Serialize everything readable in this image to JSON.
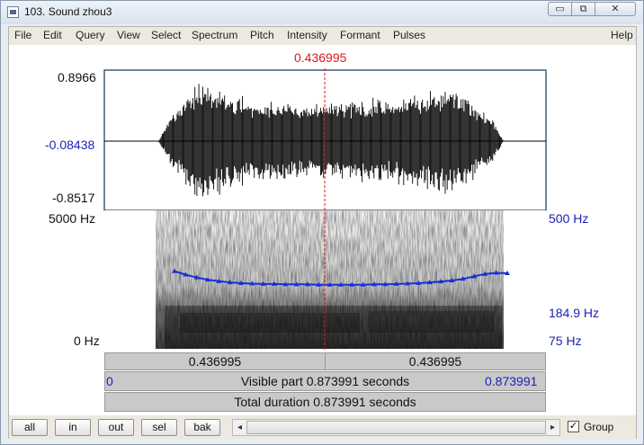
{
  "window": {
    "title": "103. Sound zhou3",
    "min_glyph": "▭",
    "max_glyph": "⧉",
    "close_glyph": "✕"
  },
  "menu": [
    "File",
    "Edit",
    "Query",
    "View",
    "Select",
    "Spectrum",
    "Pitch",
    "Intensity",
    "Formant",
    "Pulses",
    "Help"
  ],
  "cursor_time": "0.436995",
  "waveform": {
    "max": "0.8966",
    "zero_level": "-0.08438",
    "min": "-0.8517"
  },
  "spectrogram": {
    "top_freq": "5000 Hz",
    "bottom_freq": "0 Hz"
  },
  "pitch_axis": {
    "top": "500 Hz",
    "current": "184.9 Hz",
    "bottom": "75 Hz"
  },
  "segments": {
    "left": "0.436995",
    "right": "0.436995"
  },
  "visible": {
    "start": "0",
    "label": "Visible part 0.873991 seconds",
    "end": "0.873991"
  },
  "total": {
    "label": "Total duration 0.873991 seconds"
  },
  "buttons": {
    "all": "all",
    "in": "in",
    "out": "out",
    "sel": "sel",
    "bak": "bak"
  },
  "scroll": {
    "left_arrow": "◂",
    "right_arrow": "▸"
  },
  "group": {
    "label": "Group",
    "checked": "✓"
  },
  "colors": {
    "pitch_curve": "#1a2fd9",
    "cursor": "#d81a1a",
    "waveform": "#000000",
    "axis_blue": "#1c22b4"
  },
  "pitch_contour_hz": [
    210,
    200,
    192,
    186,
    182,
    179,
    177,
    176,
    175,
    175,
    174,
    174,
    174,
    173,
    173,
    173,
    173,
    173,
    174,
    174,
    175,
    176,
    177,
    179,
    181,
    184,
    188,
    195,
    202,
    205,
    204
  ]
}
